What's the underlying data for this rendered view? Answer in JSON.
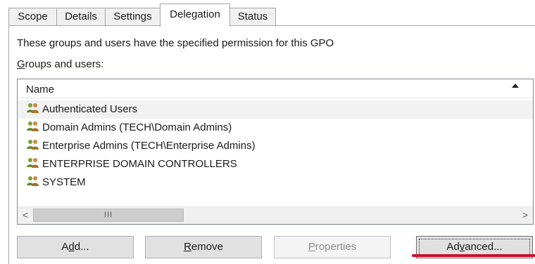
{
  "tabs": [
    {
      "label": "Scope",
      "active": false
    },
    {
      "label": "Details",
      "active": false
    },
    {
      "label": "Settings",
      "active": false
    },
    {
      "label": "Delegation",
      "active": true
    },
    {
      "label": "Status",
      "active": false
    }
  ],
  "description": "These groups and users have the specified permission for this GPO",
  "groups_label": {
    "mnemonic": "G",
    "rest": "roups and users:"
  },
  "list": {
    "column_header": "Name",
    "sort_icon": "sort-ascending-icon",
    "rows": [
      {
        "name": "Authenticated Users",
        "icon": "user-group-icon",
        "selected": true
      },
      {
        "name": "Domain Admins (TECH\\Domain Admins)",
        "icon": "user-group-icon",
        "selected": false
      },
      {
        "name": "Enterprise Admins (TECH\\Enterprise Admins)",
        "icon": "user-group-icon",
        "selected": false
      },
      {
        "name": "ENTERPRISE DOMAIN CONTROLLERS",
        "icon": "user-group-icon",
        "selected": false
      },
      {
        "name": "SYSTEM",
        "icon": "user-group-icon",
        "selected": false
      }
    ],
    "scrollbar": {
      "left_arrow": "<",
      "right_arrow": ">",
      "thumb_grip": "III"
    }
  },
  "buttons": {
    "add": {
      "mnemonic": "d",
      "before": "A",
      "after": "d...",
      "enabled": true
    },
    "remove": {
      "mnemonic": "R",
      "after": "emove",
      "enabled": true
    },
    "properties": {
      "mnemonic": "P",
      "after": "roperties",
      "enabled": false
    },
    "advanced": {
      "mnemonic": "v",
      "before": "Ad",
      "after": "anced...",
      "enabled": true,
      "focused": true
    }
  },
  "colors": {
    "annotation": "#c8102e",
    "selection": "#f2f2f2"
  }
}
